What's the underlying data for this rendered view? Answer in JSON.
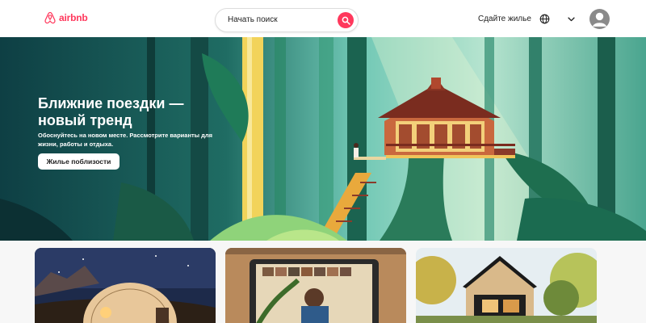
{
  "brand": {
    "name": "airbnb",
    "color": "#ff385c"
  },
  "header": {
    "search_label": "Начать поиск",
    "host_label": "Сдайте жилье",
    "icons": [
      "airbnb-logo-icon",
      "search-icon",
      "globe-icon",
      "chevron-down-icon",
      "user-avatar-icon"
    ]
  },
  "hero": {
    "title": "Ближние поездки — новый тренд",
    "subtitle": "Обоснуйтесь на новом месте. Рассмотрите варианты для жизни, работы и отдыха.",
    "button_label": "Жилье поблизости"
  },
  "cards": [
    {
      "image": "glamping-dome-night"
    },
    {
      "image": "tablet-video-call"
    },
    {
      "image": "modern-cabin-forest"
    }
  ]
}
